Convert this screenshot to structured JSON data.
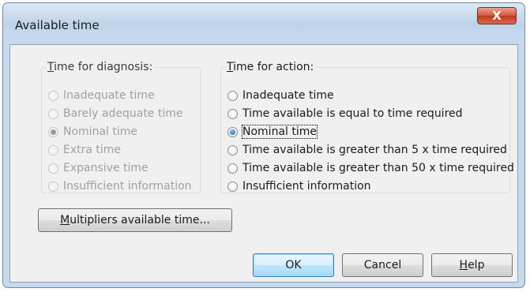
{
  "window": {
    "title": "Available time",
    "close_label": "X"
  },
  "diagnosis": {
    "legend_prefix": "T",
    "legend_rest": "ime for diagnosis:",
    "options": [
      {
        "label": "Inadequate time",
        "checked": false
      },
      {
        "label": "Barely adequate time",
        "checked": false
      },
      {
        "label": "Nominal time",
        "checked": true
      },
      {
        "label": "Extra time",
        "checked": false
      },
      {
        "label": "Expansive time",
        "checked": false
      },
      {
        "label": "Insufficient information",
        "checked": false
      }
    ]
  },
  "action": {
    "legend_prefix": "T",
    "legend_rest": "ime for action:",
    "options": [
      {
        "label": "Inadequate time",
        "checked": false
      },
      {
        "label": "Time available is equal to time required",
        "checked": false
      },
      {
        "label": "Nominal time",
        "checked": true
      },
      {
        "label": "Time available is greater than 5 x time required",
        "checked": false
      },
      {
        "label": "Time available is greater than 50 x time required",
        "checked": false
      },
      {
        "label": "Insufficient information",
        "checked": false
      }
    ]
  },
  "buttons": {
    "multipliers_prefix": "M",
    "multipliers_rest": "ultipliers available time...",
    "ok": "OK",
    "cancel": "Cancel",
    "help_prefix": "H",
    "help_rest": "elp"
  }
}
